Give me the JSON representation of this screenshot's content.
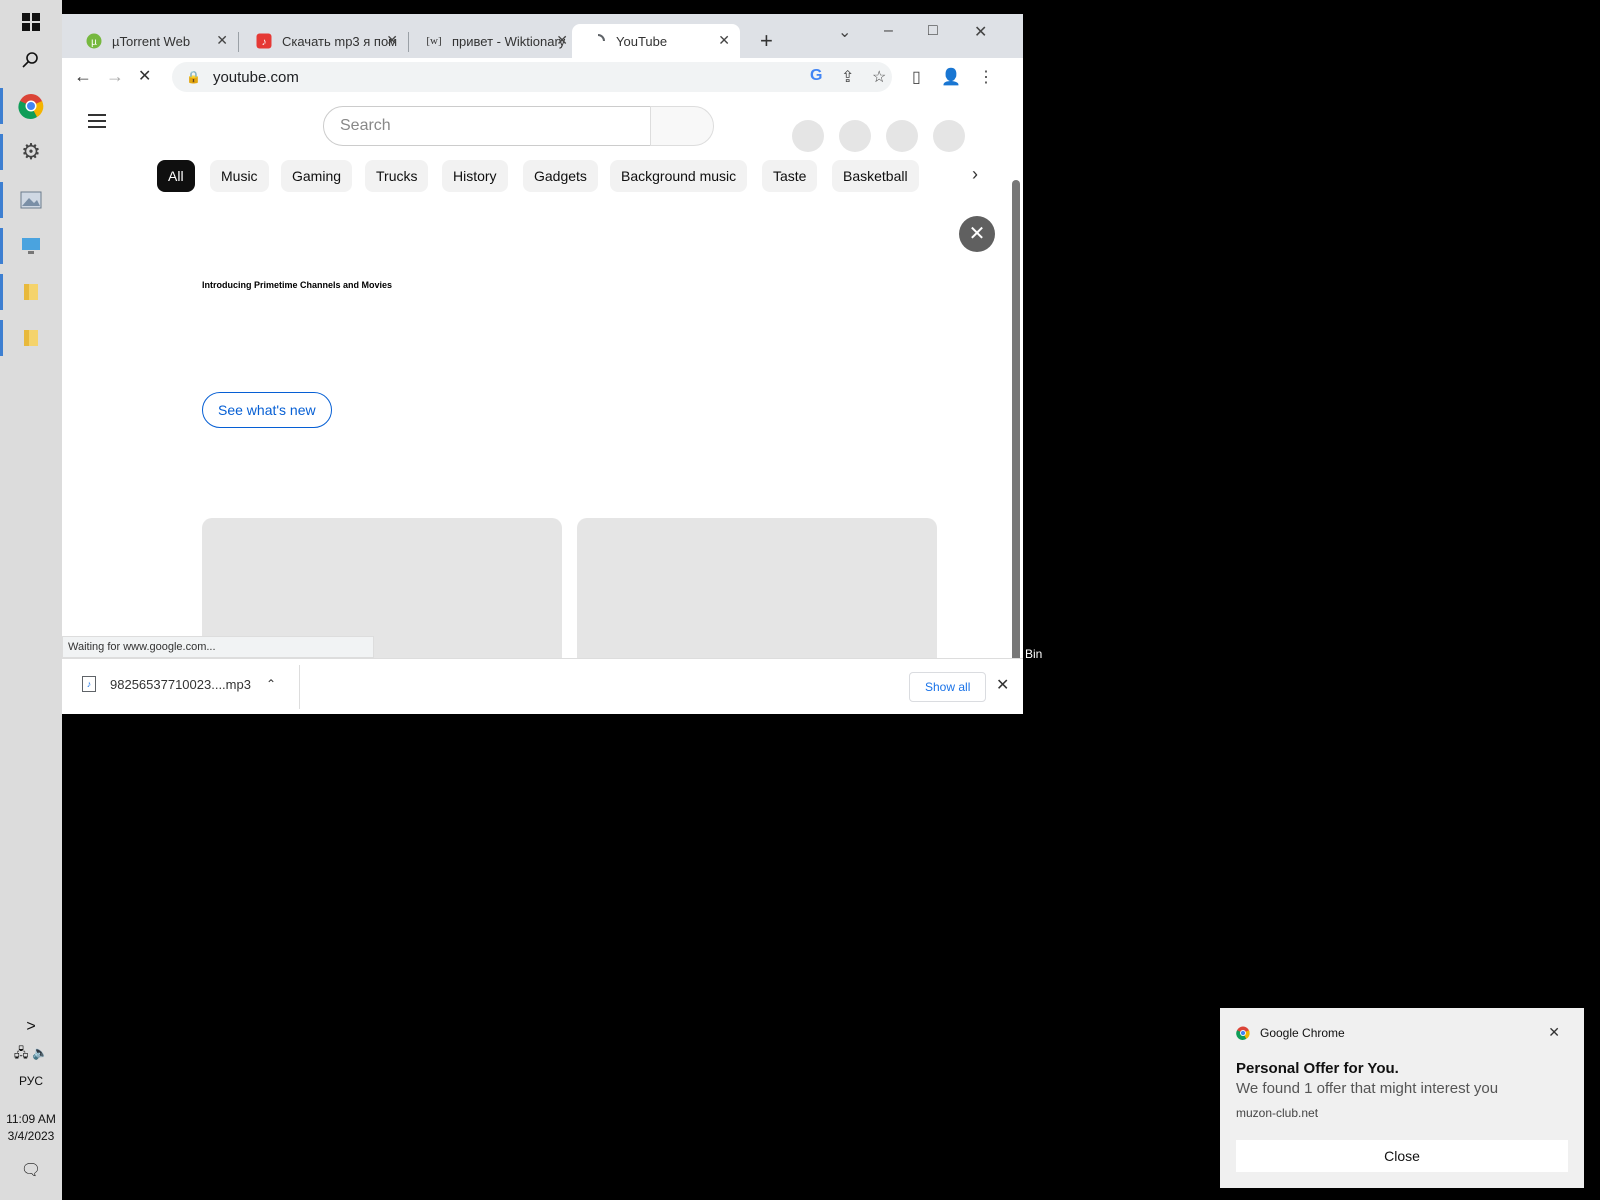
{
  "browser": {
    "tabs": [
      {
        "title": "µTorrent Web",
        "favicon": "utorrent-icon"
      },
      {
        "title": "Скачать mp3 я пом",
        "favicon": "music-site-icon"
      },
      {
        "title": "привет - Wiktionary",
        "favicon": "wiktionary-icon"
      },
      {
        "title": "YouTube",
        "favicon": "youtube-icon",
        "active": true
      }
    ],
    "new_tab": "+",
    "controls": {
      "minimize": "–",
      "maximize": "□",
      "close": "✕",
      "tab_search": "⌄"
    },
    "toolbar": {
      "back": "←",
      "forward": "→",
      "reload": "✕",
      "url": "youtube.com",
      "lock": "🔒",
      "google": "G",
      "share": "⇪",
      "star": "☆",
      "sidepanel": "▯",
      "profile": "👤",
      "menu": "⋮"
    },
    "status": "Waiting for www.google.com..."
  },
  "youtube": {
    "search_placeholder": "Search",
    "chips": [
      "All",
      "Music",
      "Gaming",
      "Trucks",
      "History",
      "Gadgets",
      "Background music",
      "Taste",
      "Basketball"
    ],
    "chips_next": "›",
    "banner": {
      "title": "Introducing Primetime Channels and Movies",
      "button": "See what's new",
      "close": "✕"
    }
  },
  "downloads": {
    "file": "98256537710023....mp3",
    "show_all": "Show all",
    "close": "✕"
  },
  "taskbar": {
    "language": "РУС",
    "time": "11:09 AM",
    "date": "3/4/2023",
    "expand": ">"
  },
  "desktop": {
    "recycle_bin_label": "Bin"
  },
  "notification": {
    "app": "Google Chrome",
    "title": "Personal Offer for You.",
    "body": "We found 1 offer that might interest you",
    "source": "muzon-club.net",
    "button": "Close",
    "close": "✕"
  },
  "colors": {
    "accent": "#065fd4",
    "chrome_link": "#1a73e8",
    "taskbar": "#dcdcdc"
  }
}
